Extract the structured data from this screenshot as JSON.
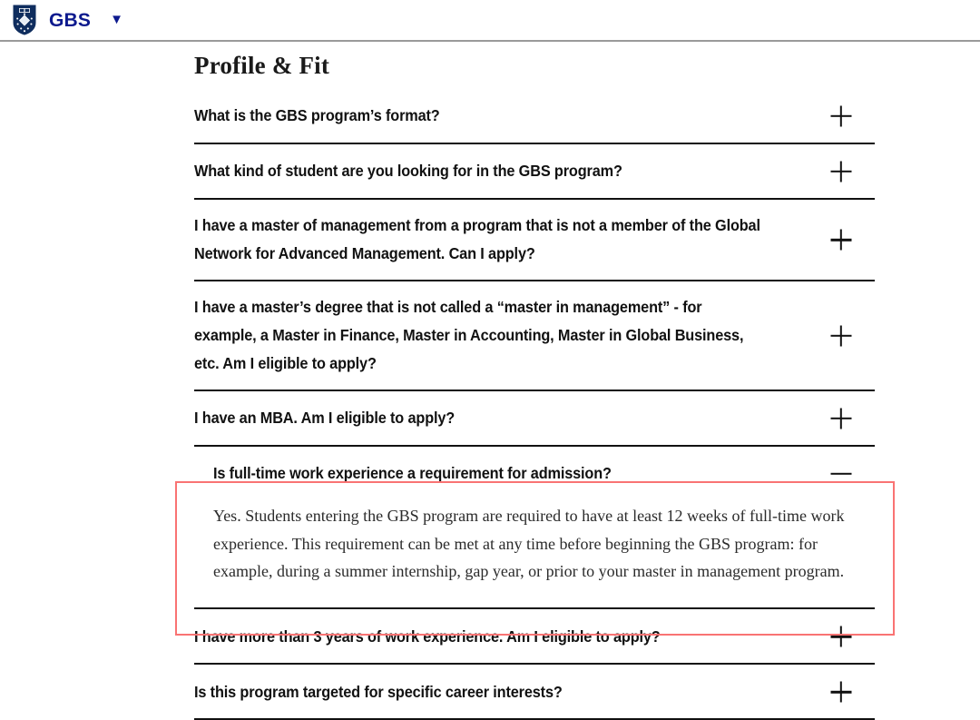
{
  "header": {
    "logo_icon": "yale-shield-icon",
    "brand": "GBS",
    "caret_icon": "chevron-down-icon",
    "brand_color": "#0d1a8e"
  },
  "main": {
    "section_title": "Profile & Fit",
    "expand_icon": "plus-icon",
    "collapse_icon": "minus-icon",
    "highlight_color": "#f97373",
    "faqs": [
      {
        "question": "What is the GBS program’s format?",
        "state": "collapsed",
        "toggle": "+",
        "answer": ""
      },
      {
        "question": "What kind of student are you looking for in the GBS program?",
        "state": "collapsed",
        "toggle": "+",
        "answer": ""
      },
      {
        "question": "I have a master of management from a program that is not a member of the Global Network for Advanced Management. Can I apply?",
        "state": "collapsed",
        "toggle": "+",
        "answer": ""
      },
      {
        "question": "I have a master’s degree that is not called a “master in management” - for example, a Master in Finance, Master in Accounting, Master in Global Business, etc. Am I eligible to apply?",
        "state": "collapsed",
        "toggle": "+",
        "answer": ""
      },
      {
        "question": "I have an MBA. Am I eligible to apply?",
        "state": "collapsed",
        "toggle": "+",
        "answer": ""
      },
      {
        "question": "Is full-time work experience a requirement for admission?",
        "state": "expanded",
        "toggle": "−",
        "answer": "Yes. Students entering the GBS program are required to have at least 12 weeks of full-time work experience. This requirement can be met at any time before beginning the GBS program: for example, during a summer internship, gap year, or prior to your master in management program."
      },
      {
        "question": "I have more than 3 years of work experience. Am I eligible to apply?",
        "state": "collapsed",
        "toggle": "+",
        "answer": ""
      },
      {
        "question": "Is this program targeted for specific career interests?",
        "state": "collapsed",
        "toggle": "+",
        "answer": ""
      }
    ]
  }
}
